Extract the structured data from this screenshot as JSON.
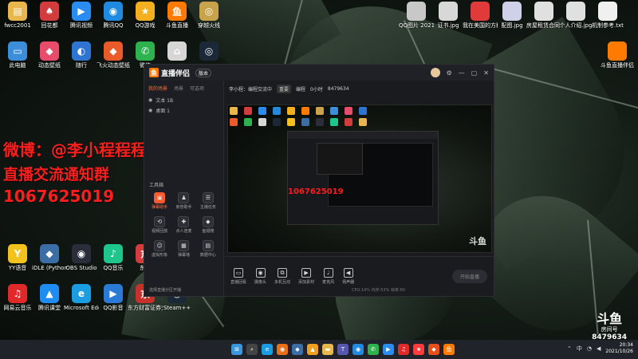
{
  "desktop": {
    "left_icons": [
      {
        "label": "fwcc2001",
        "color": "#e8b64c",
        "glyph": "▤"
      },
      {
        "label": "回花都",
        "color": "#d23c3c",
        "glyph": "♠"
      },
      {
        "label": "腾讯视频",
        "color": "#2a8cf0",
        "glyph": "▶"
      },
      {
        "label": "腾讯QQ",
        "color": "#1f8ae0",
        "glyph": "◉"
      },
      {
        "label": "QQ游戏",
        "color": "#f2b01e",
        "glyph": "★"
      },
      {
        "label": "斗鱼直播",
        "color": "#ff7a00",
        "glyph": "鱼"
      },
      {
        "label": "穿越火线",
        "color": "#c9a24c",
        "glyph": "◎"
      }
    ],
    "row2_icons": [
      {
        "label": "此电脑",
        "color": "#3d8ed8",
        "glyph": "▭"
      },
      {
        "label": "动态壁纸",
        "color": "#e84c6a",
        "glyph": "◆"
      },
      {
        "label": "随行",
        "color": "#2f74d0",
        "glyph": "◐"
      },
      {
        "label": "飞火动态壁纸",
        "color": "#ea5a2a",
        "glyph": "◆"
      },
      {
        "label": "微信",
        "color": "#2db24e",
        "glyph": "✆"
      },
      {
        "label": "",
        "color": "#d6d6d6",
        "glyph": "⌂"
      },
      {
        "label": "",
        "color": "#1b2838",
        "glyph": "◎"
      }
    ],
    "bottom_left_icons": [
      {
        "label": "YY语音",
        "color": "#f4c21c",
        "glyph": "Y"
      },
      {
        "label": "iDLE (Python 3.8 64-bit)",
        "color": "#3a6ea5",
        "glyph": "◆"
      },
      {
        "label": "OBS Studio",
        "color": "#2b2e3a",
        "glyph": "◉"
      },
      {
        "label": "QQ音乐",
        "color": "#1ec58d",
        "glyph": "♪"
      },
      {
        "label": "东方",
        "color": "#d23c3c",
        "glyph": "东"
      }
    ],
    "bottom_left_icons2": [
      {
        "label": "网易云音乐",
        "color": "#e02a2a",
        "glyph": "♫"
      },
      {
        "label": "腾讯课堂",
        "color": "#1e8cf0",
        "glyph": "▲"
      },
      {
        "label": "Microsoft Edge",
        "color": "#1b9de2",
        "glyph": "e"
      },
      {
        "label": "QQ影音",
        "color": "#2a7ad6",
        "glyph": "▶"
      },
      {
        "label": "东方财富证券交易",
        "color": "#c8302a",
        "glyph": "东"
      },
      {
        "label": "Steam++",
        "color": "#1b2838",
        "glyph": "◎"
      }
    ],
    "right_icons": [
      {
        "label": "QQ图片 2021001...",
        "color": "#c8c8c8"
      },
      {
        "label": "证书.jpg",
        "color": "#d8d8d8"
      },
      {
        "label": "我在美国的方程组.pdf",
        "color": "#e03a3a"
      },
      {
        "label": "配图.jpg",
        "color": "#d0d0e8"
      },
      {
        "label": "房屋租赁合同.jpg",
        "color": "#e0e0e0"
      },
      {
        "label": "个人介绍.jpg",
        "color": "#e0e0e0"
      },
      {
        "label": "机制参考.txt",
        "color": "#f0f0f0"
      }
    ],
    "right_icon_extra": {
      "label": "斗鱼直播伴侣",
      "color": "#ff7a00"
    }
  },
  "overlay": {
    "weibo": "微博：@李小程程程",
    "group": "直播交流通知群",
    "number": "1067625019"
  },
  "app": {
    "name": "直播伴侣",
    "version": "版本",
    "sidebar_tabs": [
      "我的场景",
      "场景",
      "可选项"
    ],
    "scenes": [
      "文本 1B",
      "桌面 1"
    ],
    "tools_title": "工具箱",
    "tools": [
      {
        "label": "弹幕助手",
        "glyph": "▣",
        "active": true
      },
      {
        "label": "房管助手",
        "glyph": "♟",
        "active": false
      },
      {
        "label": "主播任务",
        "glyph": "☰",
        "active": false
      },
      {
        "label": "视频回放",
        "glyph": "⟲",
        "active": false
      },
      {
        "label": "点人连麦",
        "glyph": "✚",
        "active": false
      },
      {
        "label": "鱼翅榜",
        "glyph": "◆",
        "active": false
      },
      {
        "label": "虚拟形象",
        "glyph": "☺",
        "active": false
      },
      {
        "label": "弹幕墙",
        "glyph": "▦",
        "active": false
      },
      {
        "label": "数据中心",
        "glyph": "▤",
        "active": false
      }
    ],
    "sidebar_footer": "选择直播分区开播",
    "stream_title": "李小程：编程交流中",
    "stream_tag": "重要",
    "stream_meta": [
      "编程",
      "0小时",
      "8479634"
    ],
    "bottom_tools": [
      {
        "label": "直播回看",
        "glyph": "▭"
      },
      {
        "label": "摄像头",
        "glyph": "◉"
      },
      {
        "label": "多机互动",
        "glyph": "⧉"
      },
      {
        "label": "添加素材",
        "glyph": "▶"
      },
      {
        "label": "麦克风",
        "glyph": "♩"
      },
      {
        "label": "扬声器",
        "glyph": "◀"
      }
    ],
    "start_live": "开始直播",
    "stats": "CPU:14%  内存:53%  帧率:60",
    "douyu_mark": "斗鱼"
  },
  "watermark": {
    "brand": "斗鱼",
    "sub": "房间号",
    "room": "8479634"
  },
  "taskbar": {
    "apps": [
      {
        "name": "windows-start",
        "color": "#3a96dd",
        "glyph": "⊞"
      },
      {
        "name": "search",
        "color": "#444",
        "glyph": "⌕"
      },
      {
        "name": "edge",
        "color": "#1b9de2",
        "glyph": "e"
      },
      {
        "name": "firefox",
        "color": "#e8701a",
        "glyph": "◉"
      },
      {
        "name": "python",
        "color": "#3a6ea5",
        "glyph": "◆"
      },
      {
        "name": "boat",
        "color": "#f0a020",
        "glyph": "▲"
      },
      {
        "name": "folder",
        "color": "#e6b84a",
        "glyph": "▬"
      },
      {
        "name": "teams",
        "color": "#5558af",
        "glyph": "T"
      },
      {
        "name": "qq",
        "color": "#1f8ae0",
        "glyph": "◉"
      },
      {
        "name": "wechat",
        "color": "#2db24e",
        "glyph": "✆"
      },
      {
        "name": "tencent-video",
        "color": "#2a8cf0",
        "glyph": "▶"
      },
      {
        "name": "netease",
        "color": "#e02a2a",
        "glyph": "♫"
      },
      {
        "name": "game",
        "color": "#ff3b3b",
        "glyph": "★"
      },
      {
        "name": "fire",
        "color": "#e8501a",
        "glyph": "◆"
      },
      {
        "name": "douyu",
        "color": "#ff7a00",
        "glyph": "鱼"
      }
    ],
    "time": "20:34",
    "date": "2021/10/26",
    "lang": "中"
  }
}
